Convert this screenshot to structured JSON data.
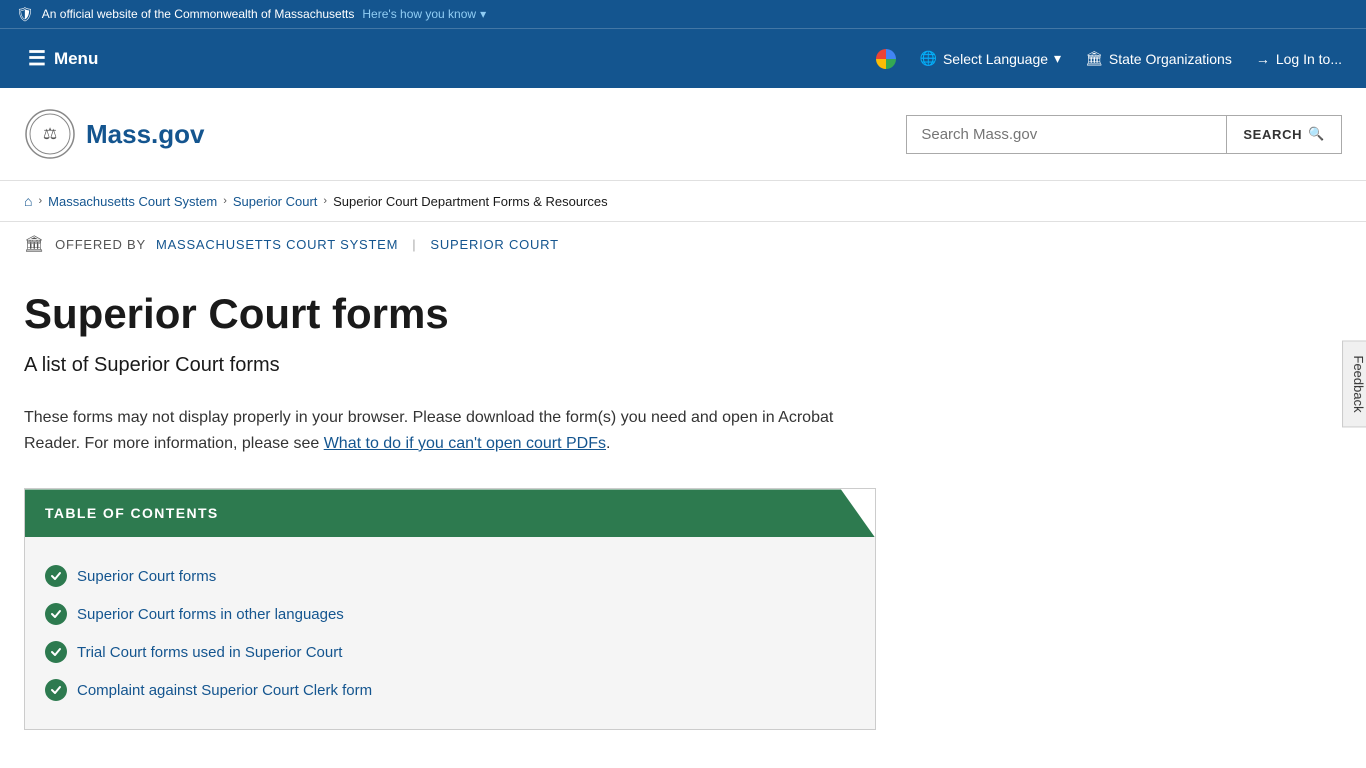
{
  "topBanner": {
    "officialText": "An official website of the Commonwealth of Massachusetts",
    "heresHow": "Here's how you know"
  },
  "nav": {
    "menuLabel": "Menu",
    "selectLanguage": "Select Language",
    "stateOrganizations": "State Organizations",
    "logIn": "Log In to..."
  },
  "header": {
    "logoText": "Mass.gov",
    "searchPlaceholder": "Search Mass.gov",
    "searchButton": "SEARCH"
  },
  "breadcrumb": {
    "home": "Home",
    "massCourtSystem": "Massachusetts Court System",
    "superiorCourt": "Superior Court",
    "current": "Superior Court Department Forms & Resources"
  },
  "offeredBy": {
    "label": "OFFERED BY",
    "org1": "Massachusetts Court System",
    "org2": "Superior Court"
  },
  "page": {
    "title": "Superior Court forms",
    "subtitle": "A list of Superior Court forms",
    "descriptionPart1": "These forms may not display properly in your browser. Please download the form(s) you need and open in Acrobat Reader. For more information, please see ",
    "descriptionLink": "What to do if you can't open court PDFs",
    "descriptionEnd": "."
  },
  "toc": {
    "heading": "TABLE OF CONTENTS",
    "items": [
      {
        "label": "Superior Court forms",
        "href": "#"
      },
      {
        "label": "Superior Court forms in other languages",
        "href": "#"
      },
      {
        "label": "Trial Court forms used in Superior Court",
        "href": "#"
      },
      {
        "label": "Complaint against Superior Court Clerk form",
        "href": "#"
      }
    ]
  },
  "feedback": {
    "label": "Feedback"
  }
}
